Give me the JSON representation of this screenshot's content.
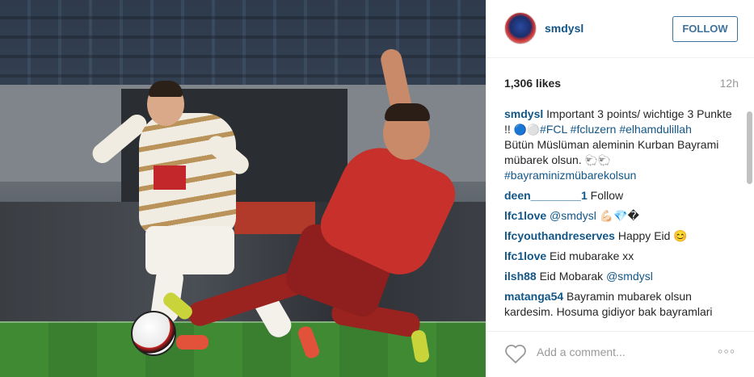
{
  "post": {
    "username": "smdysl",
    "follow_label": "FOLLOW",
    "likes": "1,306 likes",
    "time_ago": "12h",
    "add_comment_placeholder": "Add a comment...",
    "more_label": "◦◦◦"
  },
  "caption": {
    "user": "smdysl",
    "text1": "Important 3 points/ wichtige 3 Punkte !! ",
    "emoji1": "🔵⚪",
    "tag1": "#FCL",
    "tag2": "#fcluzern",
    "tag3": "#elhamdulillah",
    "text2": "Bütün Müslüman aleminin Kurban Bayrami mübarek olsun. ",
    "emoji2": "🐑🐑",
    "tag4": "#bayraminizmübarekolsun"
  },
  "comments": [
    {
      "user": "deen________1",
      "text": " Follow"
    },
    {
      "user": "lfc1love",
      "mention": "@smdysl",
      "text": " 💪🏻💎�"
    },
    {
      "user": "lfcyouthandreserves",
      "text": " Happy Eid 😊"
    },
    {
      "user": "lfc1love",
      "text": " Eid mubarake xx"
    },
    {
      "user": "ilsh88",
      "text": " Eid Mobarak ",
      "mention": "@smdysl"
    },
    {
      "user": "matanga54",
      "text": " Bayramin mubarek olsun kardesim. Hosuma gidiyor bak bayramlari"
    }
  ],
  "icons": {
    "heart": "heart-icon",
    "more": "more-options-icon"
  },
  "colors": {
    "link": "#125688",
    "follow_border": "#3f729b",
    "muted": "#999999"
  }
}
